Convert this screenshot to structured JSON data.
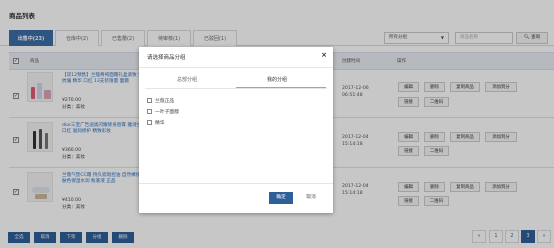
{
  "page": {
    "title": "商品列表"
  },
  "tabs": [
    {
      "label": "出售中(23)",
      "active": true
    },
    {
      "label": "仓库中(2)",
      "active": false
    },
    {
      "label": "已售罄(2)",
      "active": false
    },
    {
      "label": "待审核(1)",
      "active": false
    },
    {
      "label": "已驳回(1)",
      "active": false
    }
  ],
  "toolbar": {
    "category_select": "所有分组",
    "search_placeholder": "商品名称",
    "query_label": "查询"
  },
  "table": {
    "headers": {
      "product": "商品",
      "created": "创建时间",
      "actions": "操作"
    },
    "rows": [
      {
        "title": "【双12预售】兰蔻菁纯面霜礼盒紧致提亮滋润修护 抗皱 精华 口红 13支装限量",
        "title_visible": "【双12预售】兰蔻菁纯面霜礼盒紧致 赠礼 抗皱 精华 口红 13支装限量 面霜",
        "price": "¥270.00",
        "category": "分类：美妆",
        "date": "2017-12-06",
        "time": "06:51:48",
        "actions_top": [
          "编辑",
          "删除",
          "复制商品",
          "添加到分"
        ],
        "actions_bottom": [
          "链接",
          "二维码"
        ]
      },
      {
        "title": "dior三宝广告迪奥闪耀修身唇膏 雅诗兰黛口红 滋润修护 精致彩妆",
        "price": "¥360.00",
        "category": "分类：美妆",
        "date": "2017-12-04",
        "time": "15:14:18",
        "actions_top": [
          "编辑",
          "删除",
          "复制商品",
          "添加到分"
        ],
        "actions_bottom": [
          "链接",
          "二维码"
        ]
      },
      {
        "title": "兰蔻气垫CC霜 持久遮瑕控油 自然裸妆亮肤色保湿水润 粉底液 正品",
        "price": "¥410.00",
        "category": "分类：美妆",
        "date": "2017-12-04",
        "time": "15:14:18",
        "actions_top": [
          "编辑",
          "删除",
          "复制商品",
          "添加到分"
        ],
        "actions_bottom": [
          "链接",
          "二维码"
        ]
      }
    ]
  },
  "bulk": [
    "全选",
    "取消",
    "下架",
    "分组",
    "删除"
  ],
  "pagination": {
    "prev": "«",
    "pages": [
      "1",
      "2",
      "3"
    ],
    "current": "3",
    "next": "»"
  },
  "modal": {
    "title": "请选择商品分组",
    "tabs": [
      "总部分组",
      "我的分组"
    ],
    "active_tab": "我的分组",
    "items": [
      "兰蔻正品",
      "一叶子面膜",
      "精华"
    ],
    "ok": "确定",
    "cancel": "取消"
  },
  "colors": {
    "primary": "#2f5f99",
    "link": "#2a6fbf",
    "active_tab_underline": "#e08a8a"
  }
}
